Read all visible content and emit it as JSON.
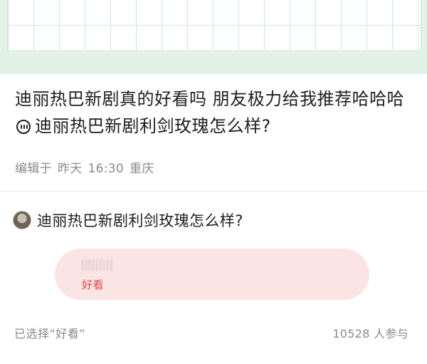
{
  "post": {
    "text": "迪丽热巴新剧真的好看吗 朋友极力给我推荐哈哈哈",
    "topic_icon": "topic-bubble-icon",
    "topic_title": "迪丽热巴新剧利剑玫瑰怎么样?",
    "meta": {
      "edited_label": "编辑于",
      "day": "昨天",
      "time": "16:30",
      "location": "重庆"
    }
  },
  "poll": {
    "question": "迪丽热巴新剧利剑玫瑰怎么样?",
    "selected_option_label": "好看",
    "selected_summary": "已选择“好看”",
    "participants": "10528 人参与"
  },
  "colors": {
    "banner_green": "#e2f2e6",
    "option_pink": "#fbe4e4",
    "option_text_red": "#e0454a",
    "meta_gray": "#8a8a8a"
  }
}
